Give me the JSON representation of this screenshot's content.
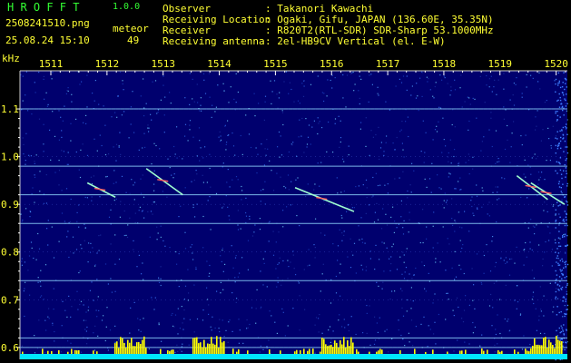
{
  "header": {
    "app_name": "H R O F F T",
    "version": "1.0.0",
    "filename": "2508241510.png",
    "timestamp": "25.08.24 15:10",
    "meteor_label": "meteor",
    "meteor_count": "49",
    "info_labels": [
      "Observer",
      "Receiving Location",
      "Receiver",
      "Receiving antenna"
    ],
    "info_values": [
      ": Takanori Kawachi",
      ": Ogaki, Gifu, JAPAN (136.60E, 35.35N)",
      ": R820T2(RTL-SDR) SDR-Sharp 53.1000MHz",
      ": 2el-HB9CV Vertical (el. E-W)"
    ]
  },
  "colors": {
    "header_yellow": "#ffff33",
    "header_green": "#33ff33",
    "background": "#00006e",
    "baseline_band": "#00e5ff",
    "activity_yellow": "#ffff00"
  },
  "chart_data": {
    "type": "heatmap",
    "title": "",
    "ylabel": "kHz",
    "xlabel": "",
    "x_ticks": [
      "1511",
      "1512",
      "1513",
      "1514",
      "1515",
      "1516",
      "1517",
      "1518",
      "1519",
      "1520"
    ],
    "y_ticks": [
      "1.1",
      "1.0",
      "0.9",
      "0.8",
      "0.7",
      "0.6"
    ],
    "y_tick_values": [
      1.1,
      1.0,
      0.9,
      0.8,
      0.7,
      0.6
    ],
    "x_range": [
      1510.45,
      1520.2
    ],
    "y_range": [
      0.575,
      1.18
    ],
    "carrier_lines_khz": [
      1.1,
      0.98,
      0.92,
      0.86,
      0.74,
      0.62,
      0.6
    ],
    "meteor_traces": [
      {
        "t0": 1511.65,
        "t1": 1512.15,
        "f0": 0.945,
        "f1": 0.915
      },
      {
        "t0": 1512.7,
        "t1": 1513.35,
        "f0": 0.975,
        "f1": 0.92
      },
      {
        "t0": 1515.35,
        "t1": 1516.4,
        "f0": 0.935,
        "f1": 0.885
      },
      {
        "t0": 1519.3,
        "t1": 1519.85,
        "f0": 0.96,
        "f1": 0.91
      },
      {
        "t0": 1519.55,
        "t1": 1520.15,
        "f0": 0.945,
        "f1": 0.9
      }
    ]
  }
}
